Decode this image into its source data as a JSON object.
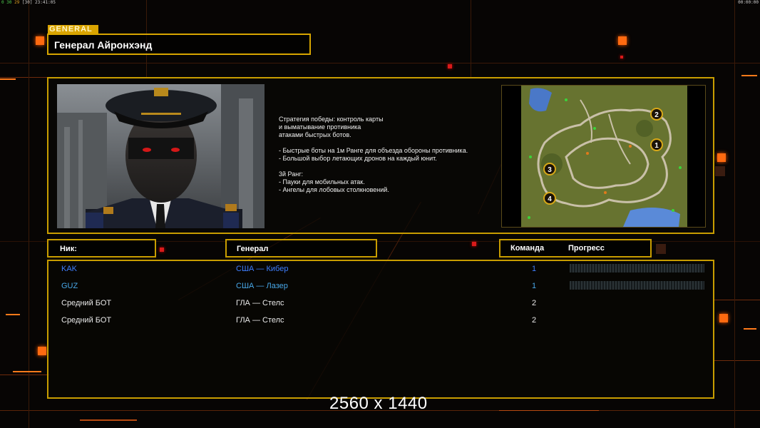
{
  "topbar": {
    "fps": "0",
    "stats_a": "30",
    "stats_b": "29",
    "stats_c": "30",
    "clock": "23:41:05",
    "timer": "00:00:00"
  },
  "general_tag": "GENERAL",
  "general_name": "Генерал Айронхэнд",
  "strategy": {
    "lines": [
      "Стратегия победы: контроль карты",
      "и выматывание противника",
      "атаками быстрых ботов.",
      "",
      "- Быстрые боты на 1м Ранге для объезда обороны противника.",
      "- Большой выбор летающих дронов на каждый юнит.",
      "",
      "3й Ранг:",
      "- Пауки для мобильных атак.",
      "- Ангелы для лобовых столкновений."
    ]
  },
  "minimap": {
    "spawns": [
      "1",
      "2",
      "3",
      "4"
    ]
  },
  "headers": {
    "nick": "Ник:",
    "general": "Генерал",
    "team": "Команда",
    "progress": "Прогресс"
  },
  "players": [
    {
      "nick": "KAK",
      "general": "США — Кибер",
      "team": "1",
      "has_progress": true,
      "color": "#3f7fff"
    },
    {
      "nick": "GUZ",
      "general": "США — Лазер",
      "team": "1",
      "has_progress": true,
      "color": "#48a8e8"
    },
    {
      "nick": "Средний БОТ",
      "general": "ГЛА — Стелс",
      "team": "2",
      "has_progress": false,
      "color": "#e8e8e8"
    },
    {
      "nick": "Средний БОТ",
      "general": "ГЛА — Стелс",
      "team": "2",
      "has_progress": false,
      "color": "#e8e8e8"
    }
  ],
  "resolution_overlay": "2560 x 1440",
  "colors": {
    "accent_gold": "#c89d00",
    "accent_orange": "#ff6a10",
    "background": "#070504"
  }
}
